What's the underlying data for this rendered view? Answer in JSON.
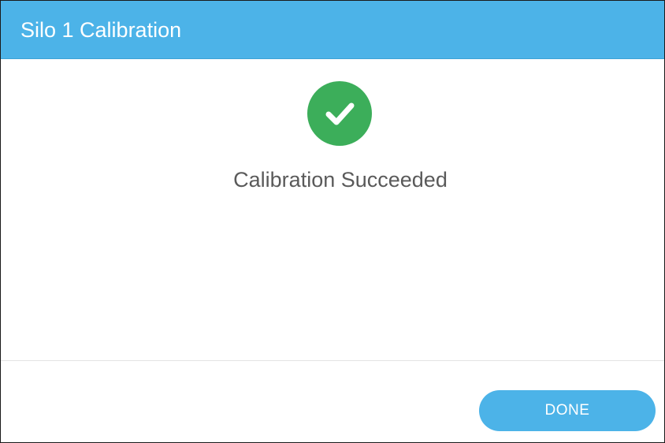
{
  "dialog": {
    "title": "Silo 1 Calibration",
    "status_icon": "check-circle-icon",
    "message": "Calibration Succeeded",
    "done_label": "DONE"
  },
  "colors": {
    "header": "#4cb3e8",
    "success": "#3cae5a",
    "button": "#4cb3e8",
    "message_text": "#5a5a5a"
  }
}
